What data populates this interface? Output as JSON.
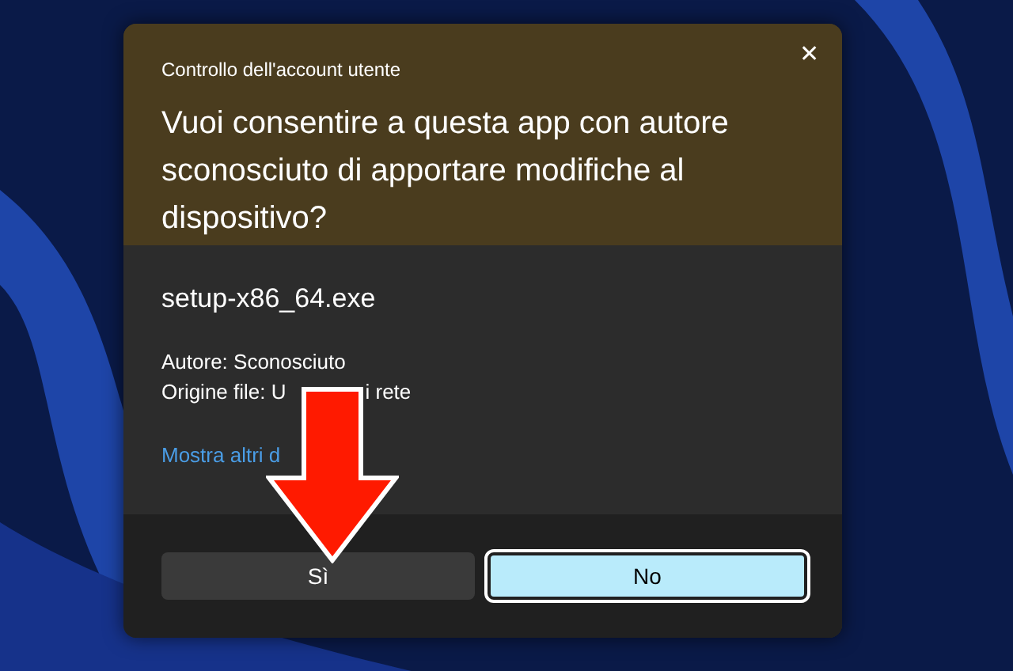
{
  "window": {
    "title": "Controllo dell'account utente",
    "close": "✕"
  },
  "heading": "Vuoi consentire a questa app con autore sconosciuto di apportare modifiche al dispositivo?",
  "program": {
    "filename": "setup-x86_64.exe",
    "publisher": "Autore: Sconosciuto",
    "origin_parts": [
      "Origine file: U",
      "i rete"
    ]
  },
  "details_link": "Mostra altri d",
  "buttons": [
    {
      "label": "Sì",
      "default": false
    },
    {
      "label": "No",
      "default": true
    }
  ]
}
